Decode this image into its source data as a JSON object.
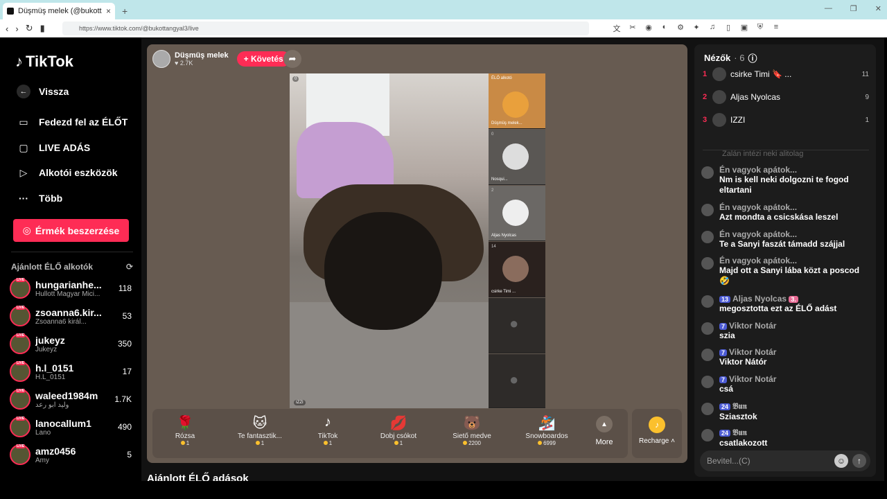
{
  "browser": {
    "tab_title": "Düşmüş melek (@bukottangy...",
    "tab_close": "×",
    "new_tab": "+",
    "url": "https://www.tiktok.com/@bukottangyal3/live"
  },
  "sidebar": {
    "logo": "TikTok",
    "back": "Vissza",
    "nav": [
      {
        "label": "Fedezd fel az ÉLŐT",
        "icon": "live-tv-icon"
      },
      {
        "label": "LIVE ADÁS",
        "icon": "video-camera-icon"
      },
      {
        "label": "Alkotói eszközök",
        "icon": "creator-tools-icon"
      },
      {
        "label": "Több",
        "icon": "more-dots-icon"
      }
    ],
    "coins_button": "Érmék beszerzése",
    "recommended_title": "Ajánlott ÉLŐ alkotók",
    "live_badge": "LIVE",
    "creators": [
      {
        "name": "hungarianhe...",
        "sub": "Hullott Magyar Mici...",
        "count": "118"
      },
      {
        "name": "zsoanna6.kir...",
        "sub": "Zsoanna6 királ...",
        "count": "53"
      },
      {
        "name": "jukeyz",
        "sub": "Jukeyz",
        "count": "350"
      },
      {
        "name": "h.l_0151",
        "sub": "H.L_0151",
        "count": "17"
      },
      {
        "name": "waleed1984m",
        "sub": "وليد ابو رعد",
        "count": "1.7K"
      },
      {
        "name": "lanocallum1",
        "sub": "Lano",
        "count": "490"
      },
      {
        "name": "amz0456",
        "sub": "Amy",
        "count": "5"
      }
    ]
  },
  "stage": {
    "host_name": "Düşmüş melek",
    "host_likes": "2.7K",
    "follow": "+ Követés",
    "viewer_tag": "0",
    "host_tag": "IZZI",
    "guests": [
      {
        "count": "",
        "name": "ÉLŐ alkotó",
        "sub": "Düşmüş melek..."
      },
      {
        "count": "0",
        "name": "Nosqui..."
      },
      {
        "count": "2",
        "name": "Aljas Nyolcas"
      },
      {
        "count": "14",
        "name": "csirke Timi ..."
      },
      {
        "count": "",
        "name": ""
      },
      {
        "count": "",
        "name": ""
      }
    ],
    "gifts": [
      {
        "label": "Rózsa",
        "price": "1",
        "icon": "🌹"
      },
      {
        "label": "Te fantasztik...",
        "price": "1",
        "icon": "🐱"
      },
      {
        "label": "TikTok",
        "price": "1",
        "icon": "♪"
      },
      {
        "label": "Dobj csókot",
        "price": "1",
        "icon": "💋"
      },
      {
        "label": "Siető medve",
        "price": "2200",
        "icon": "🐻"
      },
      {
        "label": "Snowboardos",
        "price": "6999",
        "icon": "🏂"
      }
    ],
    "more": "More",
    "recharge": "Recharge"
  },
  "below_title": "Ajánlott ÉLŐ adások",
  "chat": {
    "title": "Nézők",
    "viewer_count": "· 6",
    "top_viewers": [
      {
        "rank": "1",
        "name": "csirke Timi 🔖 ...",
        "score": "11"
      },
      {
        "rank": "2",
        "name": "Aljas Nyolcas",
        "score": "9"
      },
      {
        "rank": "3",
        "name": "IZZI",
        "score": "1"
      }
    ],
    "faded": "Zalán intézi neki alitolag",
    "messages": [
      {
        "user": "Én vagyok apátok...",
        "text": "Nm is kell neki dolgozni te fogod eltartani"
      },
      {
        "user": "Én vagyok apátok...",
        "text": "Azt mondta a csicskása leszel"
      },
      {
        "user": "Én vagyok apátok...",
        "text": "Te a Sanyi faszát támadd szájjal"
      },
      {
        "user": "Én vagyok apátok...",
        "text": "Majd ott a Sanyi lába közt a poscod 🤣"
      },
      {
        "user": "Aljas Nyolcas",
        "badge": "13",
        "badge2": "3.",
        "text": "megosztotta ezt az ÉLŐ adást"
      },
      {
        "user": "Viktor Notár",
        "badge": "7",
        "text": "szia"
      },
      {
        "user": "Viktor Notár",
        "badge": "7",
        "text": "Viktor Nátór"
      },
      {
        "user": "Viktor Notár",
        "badge": "7",
        "text": "csá"
      },
      {
        "user": "𝕭𝖚𝖓",
        "badge": "24",
        "text": "Sziasztok"
      },
      {
        "user": "𝕭𝖚𝖓",
        "badge": "24",
        "text": "csatlakozott"
      }
    ],
    "input_placeholder": "Bevitel...(C)"
  }
}
